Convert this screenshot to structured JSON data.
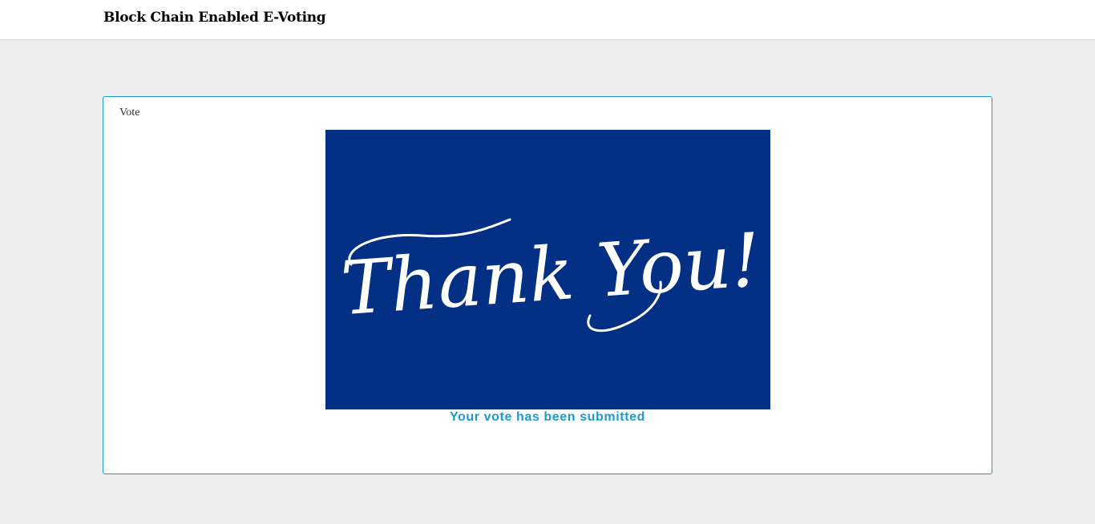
{
  "header": {
    "title": "Block Chain Enabled E-Voting"
  },
  "vote_panel": {
    "heading": "Vote",
    "image": {
      "text": "Thank You!",
      "background_color": "#033084",
      "text_color": "#ffffff"
    },
    "status_message": "Your vote has been submitted"
  },
  "colors": {
    "accent": "#1a9bd0",
    "page_background": "#ededed"
  }
}
